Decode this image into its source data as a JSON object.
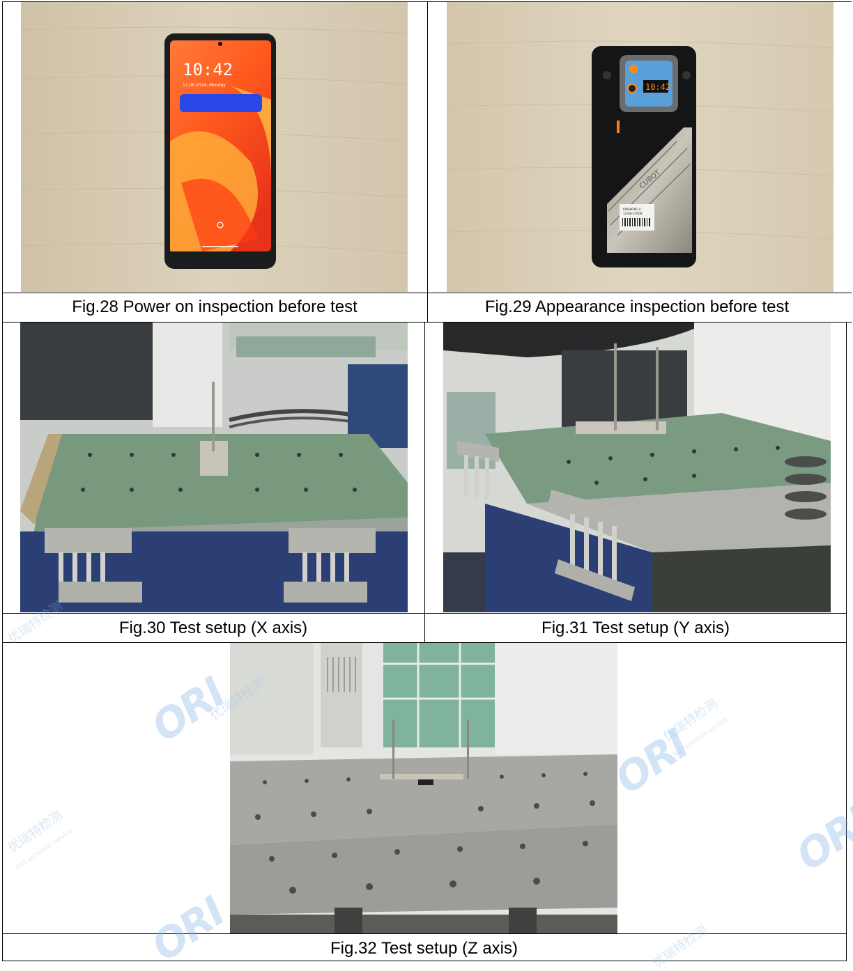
{
  "captions": {
    "fig28": "Fig.28  Power on inspection before test",
    "fig29": "Fig.29  Appearance inspection before test",
    "fig30": "Fig.30  Test setup (X axis)",
    "fig31": "Fig.31  Test setup (Y axis)",
    "fig32": "Fig.32  Test setup (Z axis)"
  },
  "phone_front": {
    "clock": "10:42",
    "date": "17.06.2024, Monday"
  },
  "phone_back": {
    "display_clock": "10:42",
    "brand": "CUBOT",
    "label_model": "KINGKONG X",
    "label_spec": "12GB+256GB"
  },
  "watermark": {
    "logo": "ORI",
    "cn": "优瑞特检测",
    "en": "ORT technical service"
  },
  "colors": {
    "line": "#000000",
    "wood": "#d9cdb5",
    "table_green": "#7fa08a",
    "machine_blue": "#2c3e72",
    "aluminum": "#b8b8b4"
  }
}
